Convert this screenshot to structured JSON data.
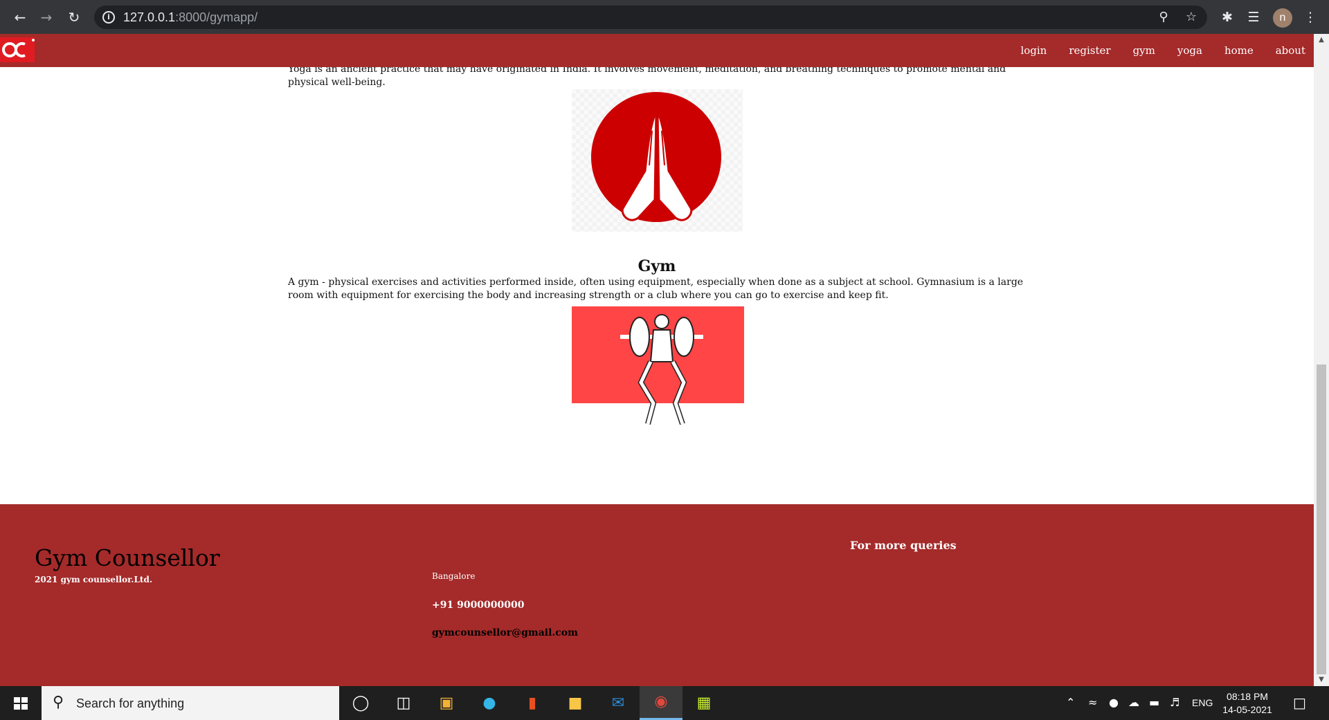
{
  "browser": {
    "url_host": "127.0.0.1",
    "url_path": ":8000/gymapp/",
    "profile_initial": "n"
  },
  "navbar": {
    "links": [
      "login",
      "register",
      "gym",
      "yoga",
      "home",
      "about"
    ]
  },
  "content": {
    "yoga_text": "Yoga is an ancient practice that may have originated in India. It involves movement, meditation, and breathing techniques to promote mental and physical well-being.",
    "gym_heading": "Gym",
    "gym_text": "A gym - physical exercises and activities performed inside, often using equipment, especially when done as a subject at school. Gymnasium is a large room with equipment for exercising the body and increasing strength or a club where you can go to exercise and keep fit."
  },
  "footer": {
    "brand": "Gym Counsellor",
    "copyright": "2021 gym counsellor.Ltd.",
    "city": "Bangalore",
    "phone": "+91 9000000000",
    "email": "gymcounsellor@gmail.com",
    "queries_heading": "For more queries"
  },
  "taskbar": {
    "search_placeholder": "Search for anything",
    "language": "ENG",
    "time": "08:18 PM",
    "date": "14-05-2021"
  },
  "colors": {
    "brand_red": "#a52a2a",
    "image_red": "#cc0000",
    "gym_img_red": "#ff4545"
  }
}
